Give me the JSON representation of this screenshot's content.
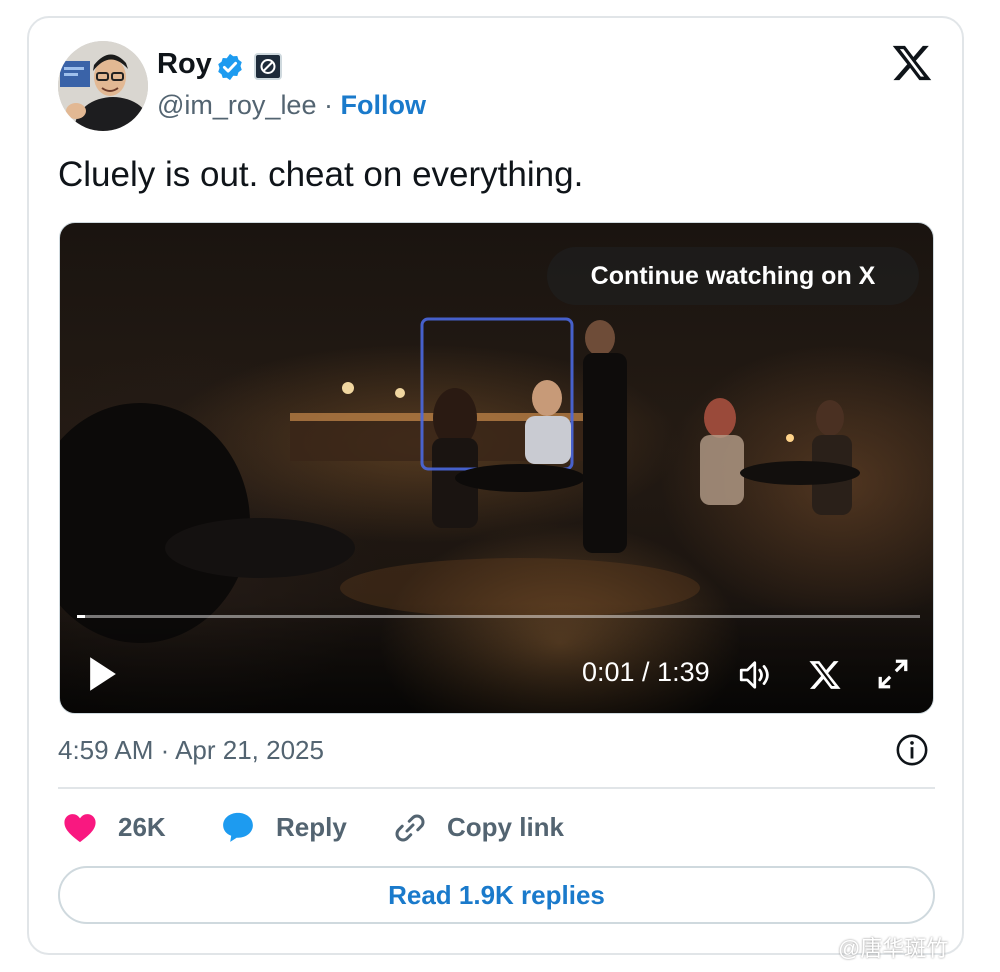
{
  "author": {
    "name": "Roy",
    "handle": "@im_roy_lee",
    "separator": "·",
    "follow_label": "Follow"
  },
  "tweet": {
    "text": "Cluely is out. cheat on everything."
  },
  "video": {
    "overlay_label": "Continue watching on X",
    "time_display": "0:01 / 1:39",
    "progress_percent": 1
  },
  "meta": {
    "timestamp": "4:59 AM · Apr 21, 2025"
  },
  "actions": {
    "likes_count": "26K",
    "reply_label": "Reply",
    "copy_link_label": "Copy link",
    "read_replies_label": "Read 1.9K replies"
  },
  "watermark": {
    "text": "@唐华斑竹"
  },
  "colors": {
    "accent": "#1a7acb",
    "verified": "#1d9bf0",
    "heart": "#f91880",
    "muted_text": "#536471",
    "text": "#0f1419",
    "border": "#cfd9de"
  },
  "icons": [
    "verified-badge-icon",
    "affiliate-badge-icon",
    "x-logo-icon",
    "play-icon",
    "volume-icon",
    "fullscreen-icon",
    "info-icon",
    "heart-icon",
    "reply-bubble-icon",
    "link-icon"
  ]
}
